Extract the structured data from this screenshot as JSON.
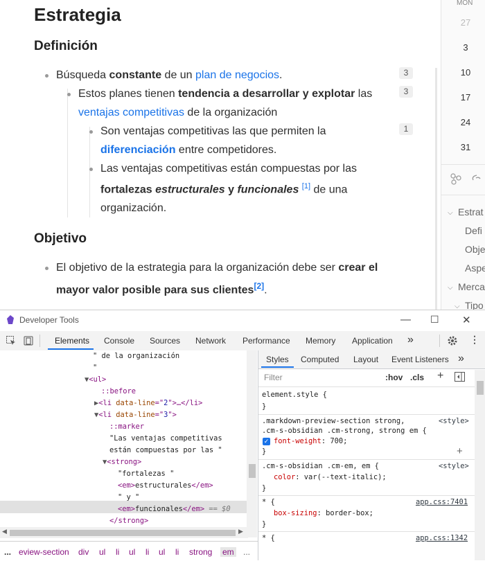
{
  "document": {
    "title": "Estrategia",
    "sections": [
      {
        "heading": "Definición"
      },
      {
        "heading": "Objetivo"
      }
    ],
    "lines": {
      "l1a": "Búsqueda ",
      "l1b": "constante",
      "l1c": " de un ",
      "l1link": "plan de negocios",
      "l1d": ".",
      "l2a": "Estos planes tienen ",
      "l2b": "tendencia a desarrollar y explotar",
      "l2c": " las",
      "l3link": "ventajas competitivas",
      "l3a": " de la organización",
      "l4a": "Son ventajas competitivas las que permiten la",
      "l5link": "diferenciación",
      "l5a": " entre competidores.",
      "l6a": "Las ventajas competitivas están compuestas por las",
      "l7a": "fortalezas ",
      "l7b": "estructurales",
      "l7c": " y ",
      "l7d": "funcionales",
      "l7sup": "[1]",
      "l7e": " de una",
      "l8a": "organización.",
      "l9a": "El objetivo de la estrategia para la organización debe ser ",
      "l9b": "crear el",
      "l10a": "mayor valor posible para sus clientes",
      "l10sup": "[2]",
      "l10b": "."
    },
    "badges": [
      "3",
      "3",
      "1"
    ]
  },
  "calendar": {
    "day_header": "MON",
    "dates": [
      "27",
      "3",
      "10",
      "17",
      "24",
      "31"
    ]
  },
  "outline": {
    "items": [
      "Estrat",
      "Defi",
      "Obje",
      "Aspe",
      "Merca",
      "Tipo"
    ]
  },
  "devtools": {
    "title": "Developer Tools",
    "tabs": [
      "Elements",
      "Console",
      "Sources",
      "Network",
      "Performance",
      "Memory",
      "Application"
    ],
    "more": "»",
    "elements": {
      "r1": "\" de la organización",
      "r2": "\"",
      "r3": "<ul>",
      "r4": "::before",
      "r5a": "<li ",
      "r5b": "data-line",
      "r5c": "=\"",
      "r5d": "2",
      "r5e": "\">…</li>",
      "r6a": "<li ",
      "r6b": "data-line",
      "r6c": "=\"",
      "r6d": "3",
      "r6e": "\">",
      "r7": "::marker",
      "r8": "\"Las ventajas competitivas",
      "r9": "están compuestas por las \"",
      "r10": "<strong>",
      "r11": "\"fortalezas \"",
      "r12a": "<em>",
      "r12b": "estructurales",
      "r12c": "</em>",
      "r13": "\" y \"",
      "r14a": "<em>",
      "r14b": "funcionales",
      "r14c": "</em>",
      "r14d": " == $0",
      "r15": "</strong>"
    },
    "breadcrumbs": [
      "...",
      "eview-section",
      "div",
      "ul",
      "li",
      "ul",
      "li",
      "ul",
      "li",
      "strong",
      "em",
      "..."
    ],
    "styles": {
      "tabs": [
        "Styles",
        "Computed",
        "Layout",
        "Event Listeners"
      ],
      "filter_placeholder": "Filter",
      "hov": ":hov",
      "cls": ".cls",
      "rule1": {
        "selector": "element.style {",
        "close": "}"
      },
      "rule2": {
        "selector1": ".markdown-preview-section strong,",
        "selector2": ".cm-s-obsidian .cm-strong, strong em {",
        "source": "<style>",
        "prop": "font-weight",
        "value": " 700;",
        "close": "}"
      },
      "rule3": {
        "selector": ".cm-s-obsidian .cm-em, em {",
        "source": "<style>",
        "prop": "color",
        "value": " var(--text-italic);",
        "close": "}"
      },
      "rule4": {
        "selector": "* {",
        "source": "app.css:7401",
        "prop": "box-sizing",
        "value": " border-box;",
        "close": "}"
      },
      "rule5": {
        "selector": "* {",
        "source": "app.css:1342"
      }
    }
  },
  "colors": {
    "link": "#1a73e8",
    "devtools_accent": "#1a73e8",
    "tag": "#881280"
  }
}
